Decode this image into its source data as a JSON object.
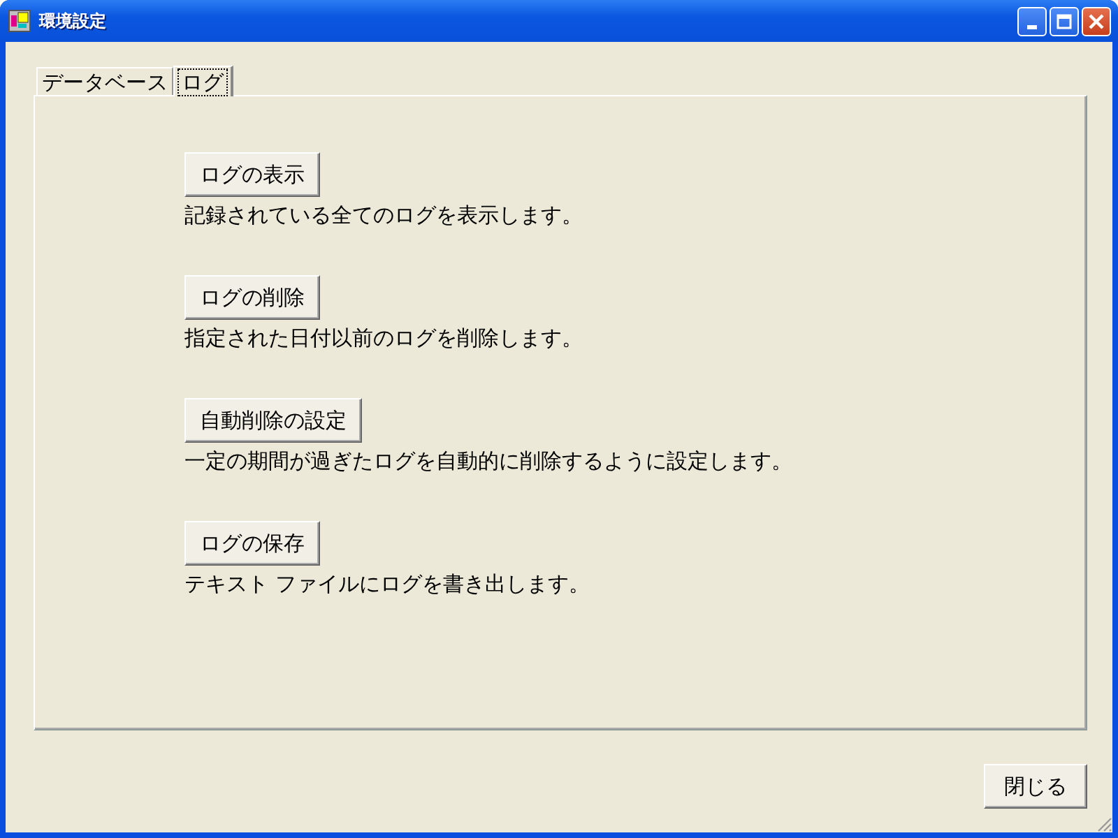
{
  "window": {
    "title": "環境設定"
  },
  "tabs": [
    {
      "label": "データベース",
      "selected": false
    },
    {
      "label": "ログ",
      "selected": true
    }
  ],
  "actions": [
    {
      "button": "ログの表示",
      "description": "記録されている全てのログを表示します。"
    },
    {
      "button": "ログの削除",
      "description": "指定された日付以前のログを削除します。"
    },
    {
      "button": "自動削除の設定",
      "description": "一定の期間が過ぎたログを自動的に削除するように設定します。"
    },
    {
      "button": "ログの保存",
      "description": "テキスト ファイルにログを書き出します。"
    }
  ],
  "close_button": "閉じる"
}
